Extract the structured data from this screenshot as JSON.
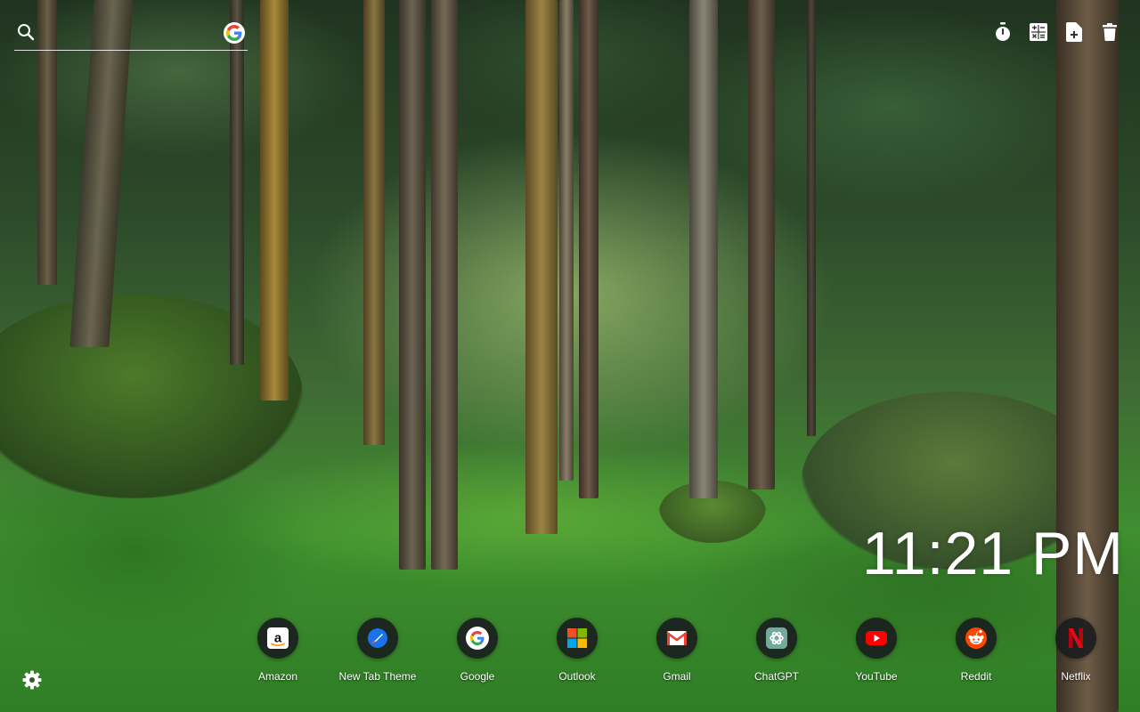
{
  "search": {
    "placeholder": "",
    "engine_icon": "google-g-icon"
  },
  "toolbar": {
    "items": [
      {
        "icon": "stopwatch-icon"
      },
      {
        "icon": "calculator-icon"
      },
      {
        "icon": "new-note-icon"
      },
      {
        "icon": "trash-icon"
      }
    ]
  },
  "clock": {
    "time": "11:21 PM"
  },
  "shortcuts": [
    {
      "label": "Amazon",
      "icon": "amazon-icon"
    },
    {
      "label": "New Tab Theme",
      "icon": "new-tab-theme-icon"
    },
    {
      "label": "Google",
      "icon": "google-icon"
    },
    {
      "label": "Outlook",
      "icon": "outlook-icon"
    },
    {
      "label": "Gmail",
      "icon": "gmail-icon"
    },
    {
      "label": "ChatGPT",
      "icon": "chatgpt-icon"
    },
    {
      "label": "YouTube",
      "icon": "youtube-icon"
    },
    {
      "label": "Reddit",
      "icon": "reddit-icon"
    },
    {
      "label": "Netflix",
      "icon": "netflix-icon"
    }
  ],
  "settings": {
    "icon": "gear-icon"
  },
  "colors": {
    "google_blue": "#4285F4",
    "google_red": "#EA4335",
    "google_yellow": "#FBBC05",
    "google_green": "#34A853",
    "youtube_red": "#FF0000",
    "reddit_orange": "#FF4500",
    "netflix_red": "#E50914",
    "gmail_red": "#EA4335",
    "chatgpt_teal": "#74AA9C"
  }
}
